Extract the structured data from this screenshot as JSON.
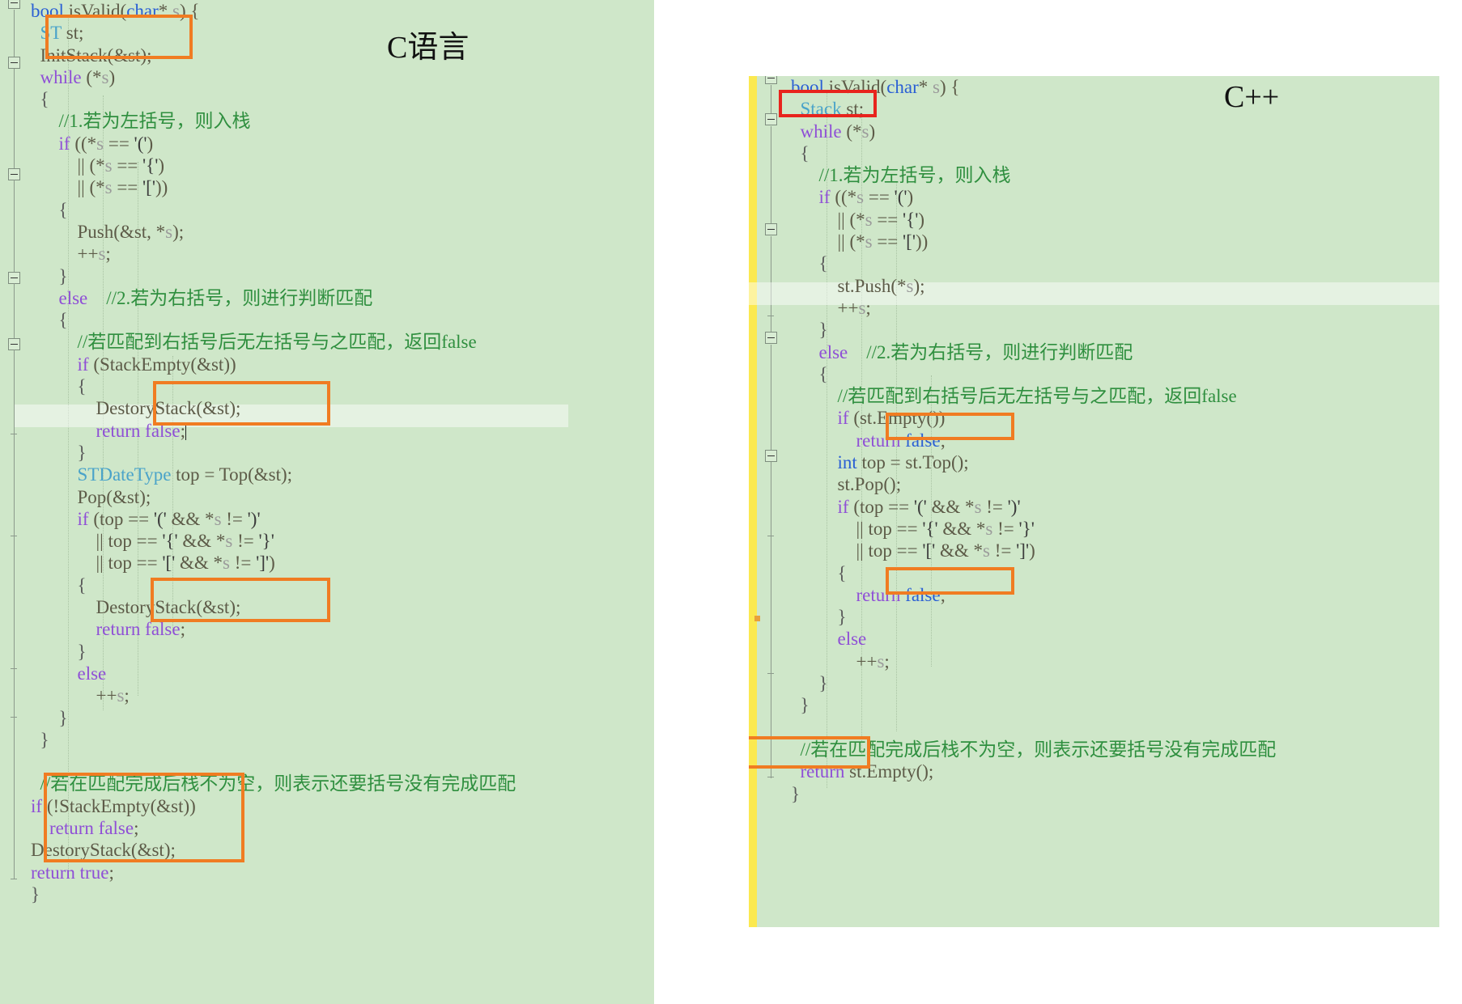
{
  "panels": {
    "c": {
      "title": "C语言",
      "language": "C",
      "background_color": "#cfe7c9",
      "code_lines": [
        "bool isValid(char* s) {",
        "    ST st;",
        "    InitStack(&st);",
        "    while (*s)",
        "    {",
        "        //1.若为左括号，则入栈",
        "        if ((*s == '(')",
        "            || (*s == '{')",
        "            || (*s == '['))",
        "        {",
        "            Push(&st, *s);",
        "            ++s;",
        "        }",
        "        else    //2.若为右括号，则进行判断匹配",
        "        {",
        "            //若匹配到右括号后无左括号与之匹配，返回false",
        "            if (StackEmpty(&st))",
        "            {",
        "                DestoryStack(&st);",
        "                return false;",
        "            }",
        "            STDateType top = Top(&st);",
        "            Pop(&st);",
        "            if (top == '(' && *s != ')'",
        "                || top == '{' && *s != '}'",
        "                || top == '[' && *s != ']')",
        "            {",
        "                DestoryStack(&st);",
        "                return false;",
        "            }",
        "            else",
        "                ++s;",
        "        }",
        "    }",
        "",
        "    //若在匹配完成后栈不为空，则表示还要括号没有完成匹配",
        "    if (!StackEmpty(&st))",
        "        return false;",
        "    DestoryStack(&st);",
        "    return true;",
        "}"
      ],
      "annotations": [
        {
          "name": "init-stack-box",
          "color": "#f07c22",
          "label": "ST st; InitStack(&st);"
        },
        {
          "name": "destroy-return-false-box-1",
          "color": "#f07c22",
          "label": "DestoryStack(&st); return false;"
        },
        {
          "name": "destroy-return-false-box-2",
          "color": "#f07c22",
          "label": "DestoryStack(&st); return false;"
        },
        {
          "name": "final-cleanup-box",
          "color": "#f07c22",
          "label": "if (!StackEmpty(&st)) return false; DestoryStack(&st); return true;"
        }
      ]
    },
    "cpp": {
      "title": "C++",
      "language": "C++",
      "background_color": "#cfe7c9",
      "change_bar_color": "#fbe94f",
      "code_lines": [
        "bool isValid(char* s) {",
        "    Stack st;",
        "    while (*s)",
        "    {",
        "        //1.若为左括号，则入栈",
        "        if ((*s == '(')",
        "            || (*s == '{')",
        "            || (*s == '['))",
        "        {",
        "            st.Push(*s);",
        "            ++s;",
        "        }",
        "        else    //2.若为右括号，则进行判断匹配",
        "        {",
        "            //若匹配到右括号后无左括号与之匹配，返回false",
        "            if (st.Empty())",
        "                return false;",
        "            int top = st.Top();",
        "            st.Pop();",
        "            if (top == '(' && *s != ')'",
        "                || top == '{' && *s != '}'",
        "                || top == '[' && *s != ']')",
        "            {",
        "                return false;",
        "            }",
        "            else",
        "                ++s;",
        "        }",
        "    }",
        "",
        "    //若在匹配完成后栈不为空，则表示还要括号没有完成匹配",
        "    return st.Empty();",
        "}"
      ],
      "annotations": [
        {
          "name": "stack-decl-box",
          "color": "#e8241d",
          "label": "Stack st;"
        },
        {
          "name": "return-false-box-1",
          "color": "#f07c22",
          "label": "return false;"
        },
        {
          "name": "return-false-box-2",
          "color": "#f07c22",
          "label": "return false;"
        },
        {
          "name": "return-empty-box",
          "color": "#f07c22",
          "label": "return st.Empty();"
        }
      ]
    }
  }
}
